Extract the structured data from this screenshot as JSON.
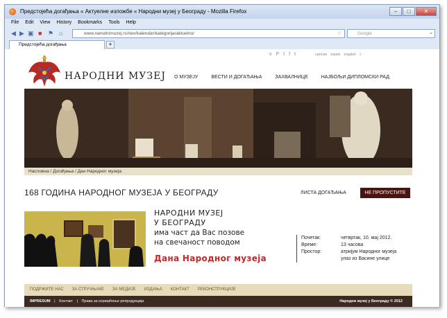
{
  "browser": {
    "title": "Предстојећа догађања « Актуелне изложбе « Народни музеј у Београду - Mozilla Firefox",
    "menu": [
      "File",
      "Edit",
      "View",
      "History",
      "Bookmarks",
      "Tools",
      "Help"
    ],
    "url": "www.narodnimuzej.rs/nev/kalendar/kategorija/aktuelno/",
    "search_placeholder": "Google",
    "tab_label": "Предстојећа догађања",
    "new_tab": "+",
    "win_min": "–",
    "win_max": "□",
    "win_close": "✕"
  },
  "site": {
    "social": [
      "v",
      "P",
      "t",
      "f",
      "t"
    ],
    "langs": [
      "српски",
      "srpski",
      "english"
    ],
    "brand": "НАРОДНИ МУЗЕЈ",
    "nav": [
      "О МУЗЕЈУ",
      "ВЕСТИ И ДОГАЂАЊА",
      "ЗАХВАЛНИЦЕ",
      "НАЈБОЉИ ДИПЛОМСКИ РАД"
    ],
    "breadcrumb": "Насловна / Догађања / Дан Народног музеја",
    "headline": "168 ГОДИНА НАРОДНОГ МУЗЕЈА У БЕОГРАДУ",
    "lista": "ЛИСТА ДОГАЂАЊА",
    "nepropustite": "НЕ ПРОПУСТИТЕ",
    "invite_l1a": "НАРОДНИ МУЗЕЈ",
    "invite_l1b": "У БЕОГРАДУ",
    "invite_l2a": "има част да Вас позове",
    "invite_l2b": "на свечаност поводом",
    "invite_l3": "Дана Народног музеја",
    "details": [
      {
        "k": "Почетак:",
        "v": "четвртак, 10. мај 2012."
      },
      {
        "k": "Време:",
        "v": "13 часова"
      },
      {
        "k": "Простор:",
        "v": "атријум Народног музеја"
      },
      {
        "k": "",
        "v": "улаз из Васине улице"
      }
    ],
    "footer_nav": [
      "ПОДРЖИТЕ НАС",
      "ЗА СТРУЧЊАКЕ",
      "ЗА МЕДИЈЕ",
      "ИЗДАЊА",
      "КОНТАКТ",
      "РЕКОНСТРУКЦИЈЕ"
    ],
    "footer_links": [
      "IMPRESUM",
      "|",
      "Контакт",
      "|",
      "Права за коришћење репродукција"
    ],
    "copyright": "Народни музеј у Београду © 2012"
  },
  "colors": {
    "dark_red": "#4a1411",
    "accent_red": "#c0282a",
    "beige": "#e6dcbb"
  }
}
